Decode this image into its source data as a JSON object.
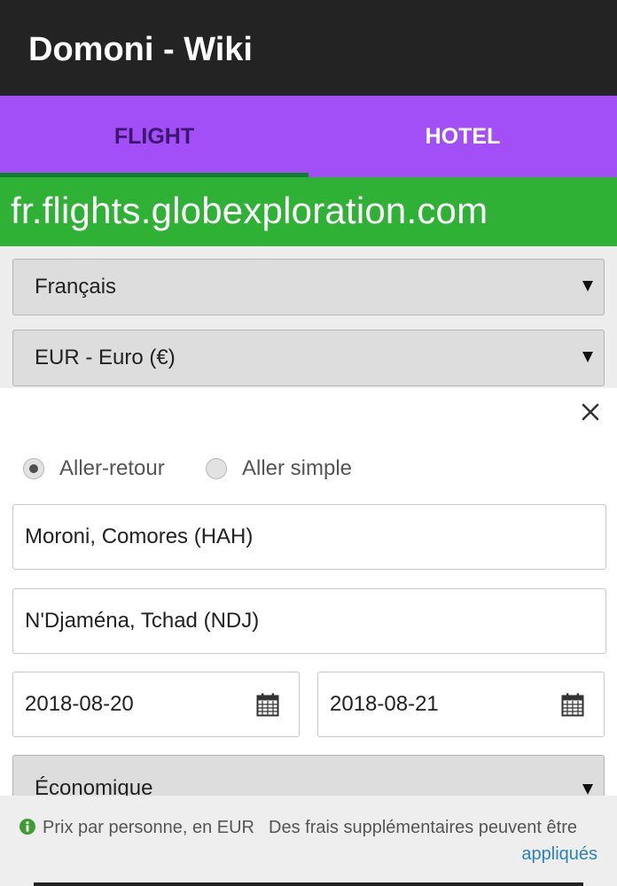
{
  "app": {
    "title": "Domoni - Wiki"
  },
  "tabs": [
    {
      "label": "FLIGHT",
      "active": true
    },
    {
      "label": "HOTEL",
      "active": false
    }
  ],
  "banner": {
    "domain": "fr.flights.globexploration.com"
  },
  "settings": {
    "language": "Français",
    "currency": "EUR - Euro (€)"
  },
  "form": {
    "trip_type": {
      "selected": "Aller-retour",
      "options": [
        "Aller-retour",
        "Aller simple"
      ]
    },
    "origin": "Moroni, Comores (HAH)",
    "destination": "N'Djaména, Tchad (NDJ)",
    "depart_date": "2018-08-20",
    "return_date": "2018-08-21",
    "cabin_class": "Économique"
  },
  "footer": {
    "price_note": "Prix par personne, en EUR",
    "fees_note_part1": "Des frais supplémentaires peuvent être",
    "fees_note_part2": "appliqués"
  },
  "icons": {
    "close": "close-icon",
    "calendar": "calendar-icon",
    "info": "info-icon",
    "dropdown": "chevron-down-icon"
  },
  "colors": {
    "appbar": "#232323",
    "tabbar": "#a24ff7",
    "tab_indicator": "#0e7f2c",
    "banner": "#2eb135",
    "link": "#2a83b4"
  }
}
